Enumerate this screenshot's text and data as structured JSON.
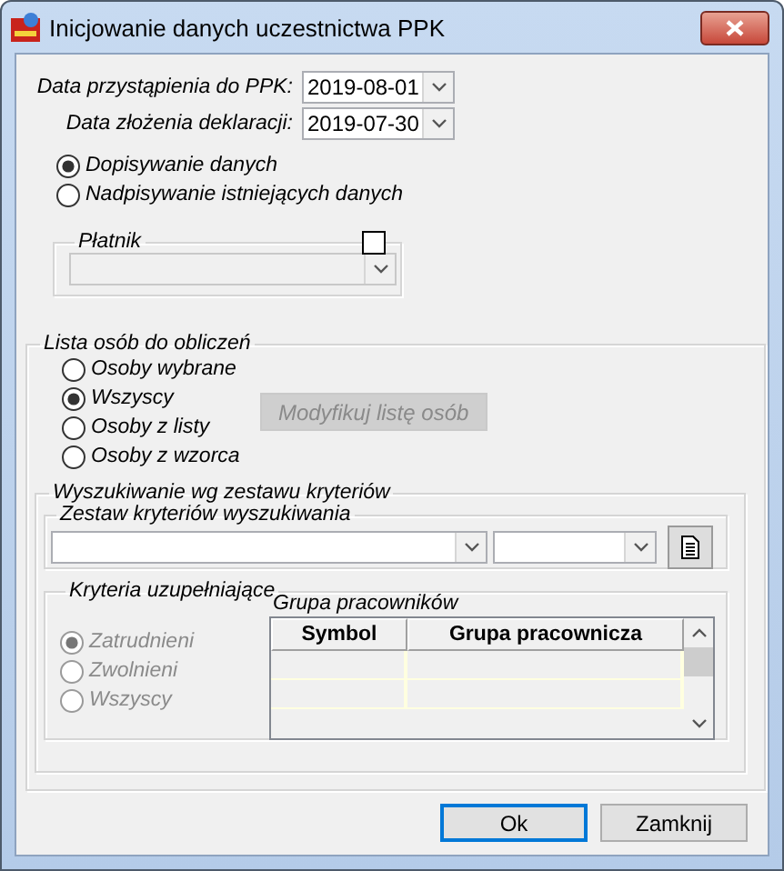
{
  "window": {
    "title": "Inicjowanie danych uczestnictwa PPK"
  },
  "dates": [
    {
      "label": "Data przystąpienia do PPK:",
      "value": "2019-08-01"
    },
    {
      "label": "Data złożenia deklaracji:",
      "value": "2019-07-30"
    }
  ],
  "mode_options": [
    {
      "label": "Dopisywanie danych",
      "selected": true
    },
    {
      "label": "Nadpisywanie istniejących danych",
      "selected": false
    }
  ],
  "payer": {
    "legend": "Płatnik",
    "checked": false,
    "disabled": true
  },
  "person_list": {
    "legend": "Lista osób do obliczeń",
    "options": [
      {
        "label": "Osoby wybrane",
        "selected": false
      },
      {
        "label": "Wszyscy",
        "selected": true
      },
      {
        "label": "Osoby z listy",
        "selected": false
      },
      {
        "label": "Osoby z wzorca",
        "selected": false
      }
    ],
    "modify_button": {
      "label": "Modyfikuj listę osób",
      "disabled": true
    }
  },
  "search": {
    "legend": "Wyszukiwanie wg zestawu kryteriów",
    "criteria_set": {
      "legend": "Zestaw kryteriów wyszukiwania"
    },
    "supplementary": {
      "legend": "Kryteria uzupełniające",
      "options": [
        {
          "label": "Zatrudnieni",
          "selected": true,
          "disabled": true
        },
        {
          "label": "Zwolnieni",
          "selected": false,
          "disabled": true
        },
        {
          "label": "Wszyscy",
          "selected": false,
          "disabled": true
        }
      ],
      "groups": {
        "title": "Grupa pracowników",
        "columns": [
          "Symbol",
          "Grupa pracownicza"
        ]
      }
    }
  },
  "buttons": [
    {
      "label": "Ok",
      "default": true
    },
    {
      "label": "Zamknij",
      "default": false
    }
  ]
}
